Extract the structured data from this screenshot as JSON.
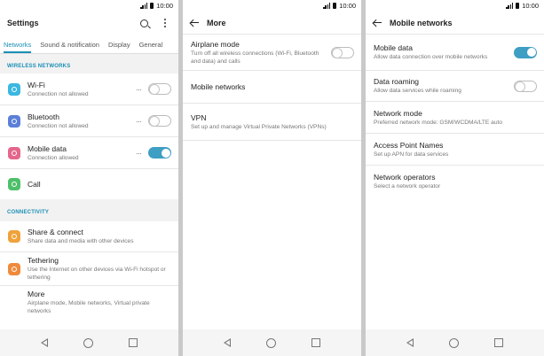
{
  "status": {
    "time": "10:00"
  },
  "settings": {
    "title": "Settings",
    "tabs": [
      "Networks",
      "Sound & notification",
      "Display",
      "General"
    ],
    "wireless_header": "WIRELESS NETWORKS",
    "wifi": {
      "title": "Wi-Fi",
      "subtitle": "Connection not allowed",
      "on": false,
      "icon_color": "#3bb7e0"
    },
    "bluetooth": {
      "title": "Bluetooth",
      "subtitle": "Connection not allowed",
      "on": false,
      "icon_color": "#5c7fd8"
    },
    "mobile_data": {
      "title": "Mobile data",
      "subtitle": "Connection allowed",
      "on": true,
      "icon_color": "#e5668c"
    },
    "call": {
      "title": "Call",
      "icon_color": "#4fbf6a"
    },
    "connectivity_header": "CONNECTIVITY",
    "share": {
      "title": "Share & connect",
      "subtitle": "Share data and media with other devices",
      "icon_color": "#f0a23a"
    },
    "tethering": {
      "title": "Tethering",
      "subtitle": "Use the Internet on other devices via Wi-Fi hotspot or tethering",
      "icon_color": "#f08a3a"
    },
    "more": {
      "title": "More",
      "subtitle": "Airplane mode, Mobile networks, Virtual private networks"
    }
  },
  "more_screen": {
    "title": "More",
    "airplane": {
      "title": "Airplane mode",
      "subtitle": "Turn off all wireless connections (Wi-Fi, Bluetooth and data) and calls",
      "on": false
    },
    "mobile_networks": {
      "title": "Mobile networks"
    },
    "vpn": {
      "title": "VPN",
      "subtitle": "Set up and manage Virtual Private Networks (VPNs)"
    }
  },
  "mobile_networks_screen": {
    "title": "Mobile networks",
    "mobile_data": {
      "title": "Mobile data",
      "subtitle": "Allow data connection over mobile networks",
      "on": true
    },
    "data_roaming": {
      "title": "Data roaming",
      "subtitle": "Allow data services while roaming",
      "on": false
    },
    "network_mode": {
      "title": "Network mode",
      "subtitle": "Preferred network mode: GSM/WCDMA/LTE auto"
    },
    "apn": {
      "title": "Access Point Names",
      "subtitle": "Set up APN for data services"
    },
    "operators": {
      "title": "Network operators",
      "subtitle": "Select a network operator"
    }
  },
  "colors": {
    "accent": "#1a8fb5",
    "toggle_on": "#3e9ec3"
  }
}
